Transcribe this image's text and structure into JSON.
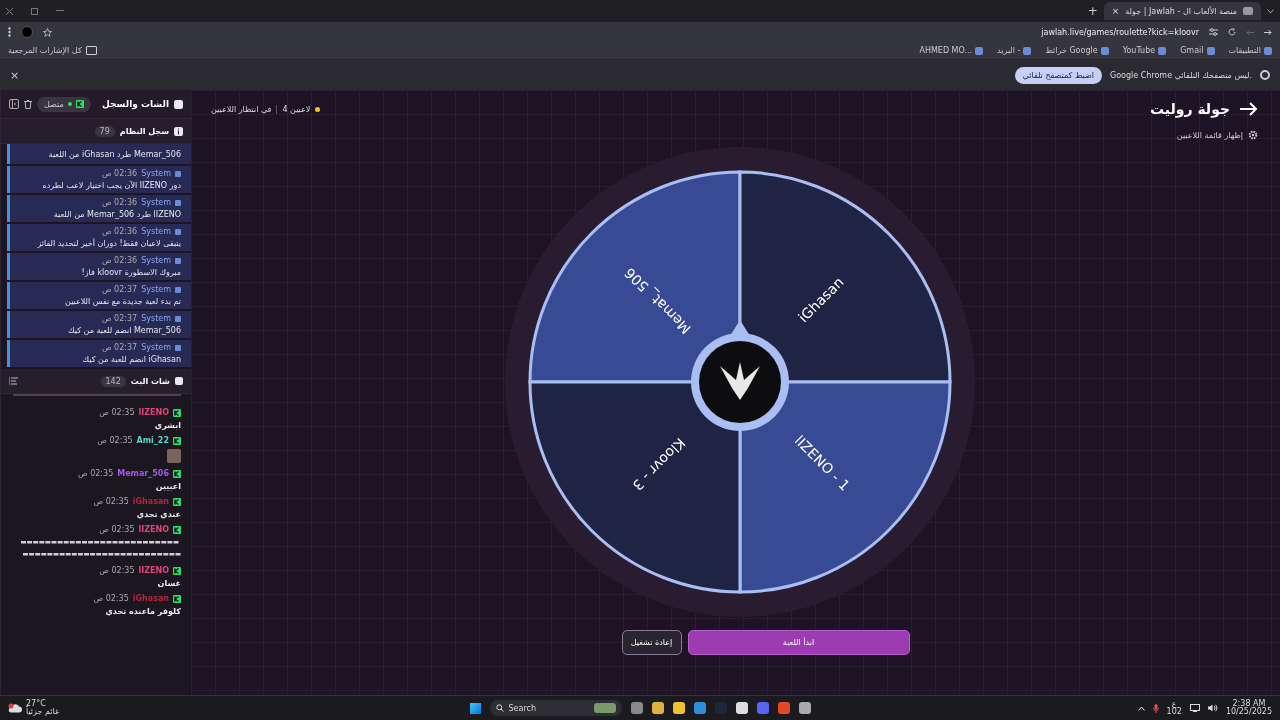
{
  "browser": {
    "tab": {
      "title": "جولة | Jawlah - منصة الألعاب ال",
      "close": "×"
    },
    "new_tab": "+",
    "url": "jawlah.live/games/roulette?kick=kloovr",
    "bookmarks": [
      {
        "label": "التطبيقات"
      },
      {
        "label": "Gmail"
      },
      {
        "label": "YouTube"
      },
      {
        "label": "خرائط Google"
      },
      {
        "label": "البريد -"
      },
      {
        "label": "AHMED MO..."
      }
    ],
    "all_bookmarks": "كل الإشارات المرجعية",
    "infobar": {
      "message": "Google Chrome ليس متصفحك التلقائي.",
      "button": "اضبط كمتصفح تلقائي",
      "close": "×"
    }
  },
  "sidebar": {
    "title": "الشات والسجل",
    "status": "متصل",
    "log": {
      "title": "سجل النظام",
      "count": "79",
      "entries": [
        {
          "text": "Memar_506 طرد iGhasan من اللعبة"
        },
        {
          "author": "System",
          "time": "02:36 ص",
          "text": "دور lIZENO الآن يجب اختيار لاعب لطرده"
        },
        {
          "author": "System",
          "time": "02:36 ص",
          "text": "lIZENO طرد Memar_506 من اللعبة"
        },
        {
          "author": "System",
          "time": "02:36 ص",
          "text": "يتبقى لاعبان فقط! دوران أخير لتحديد الفائز"
        },
        {
          "author": "System",
          "time": "02:36 ص",
          "text": "مبروك الاسطورة kloovr فاز!"
        },
        {
          "author": "System",
          "time": "02:37 ص",
          "text": "تم بدء لعبة جديدة مع نفس اللاعبين"
        },
        {
          "author": "System",
          "time": "02:37 ص",
          "text": "Memar_506 انضم للعبة من كيك"
        },
        {
          "author": "System",
          "time": "02:37 ص",
          "text": "iGhasan انضم للعبة من كيك"
        }
      ]
    },
    "chat": {
      "title": "شات البث",
      "count": "142",
      "messages": [
        {
          "kind": "text",
          "user": "lIZENO",
          "color": "#e0457b",
          "time": "02:35 ص",
          "text": "ابشري"
        },
        {
          "kind": "image",
          "user": "Ami_22",
          "color": "#5fd3c6",
          "time": "02:35 ص"
        },
        {
          "kind": "text",
          "user": "Memar_506",
          "color": "#a259e6",
          "time": "02:35 ص",
          "text": "اعبيين"
        },
        {
          "kind": "text",
          "user": "iGhasan",
          "color": "#b0263c",
          "time": "02:35 ص",
          "text": "عندي تحدي"
        },
        {
          "kind": "emotes",
          "user": "lIZENO",
          "color": "#e0457b",
          "time": "02:35 ص"
        },
        {
          "kind": "text",
          "user": "lIZENO",
          "color": "#e0457b",
          "time": "02:35 ص",
          "text": "غسان"
        },
        {
          "kind": "text",
          "user": "iGhasan",
          "color": "#b0263c",
          "time": "02:35 ص",
          "text": "كلوفر ماعنده تحدي"
        }
      ]
    }
  },
  "game": {
    "title": "جولة روليت",
    "players": "4 لاعبين",
    "status": "في انتظار اللاعبين",
    "show_players": "إظهار قائمة اللاعبين",
    "segments": [
      {
        "label": "Memat_ 506",
        "color": "#394a94"
      },
      {
        "label": "iGhasan",
        "color": "#1f2444"
      },
      {
        "label": "lIZENO - 1",
        "color": "#394a94"
      },
      {
        "label": "Kloovr - 3",
        "color": "#1f2444"
      }
    ],
    "buttons": [
      {
        "label": "ابدأ اللعبة",
        "kind": "primary"
      },
      {
        "label": "إعادة تشغيل",
        "kind": "secondary"
      }
    ]
  },
  "taskbar": {
    "weather": "27°C",
    "forecast": "غائم جزئياً",
    "search": "Search",
    "lang": "ع",
    "lang_sub": "102",
    "time": "2:38 AM",
    "date": "10/25/2025"
  }
}
